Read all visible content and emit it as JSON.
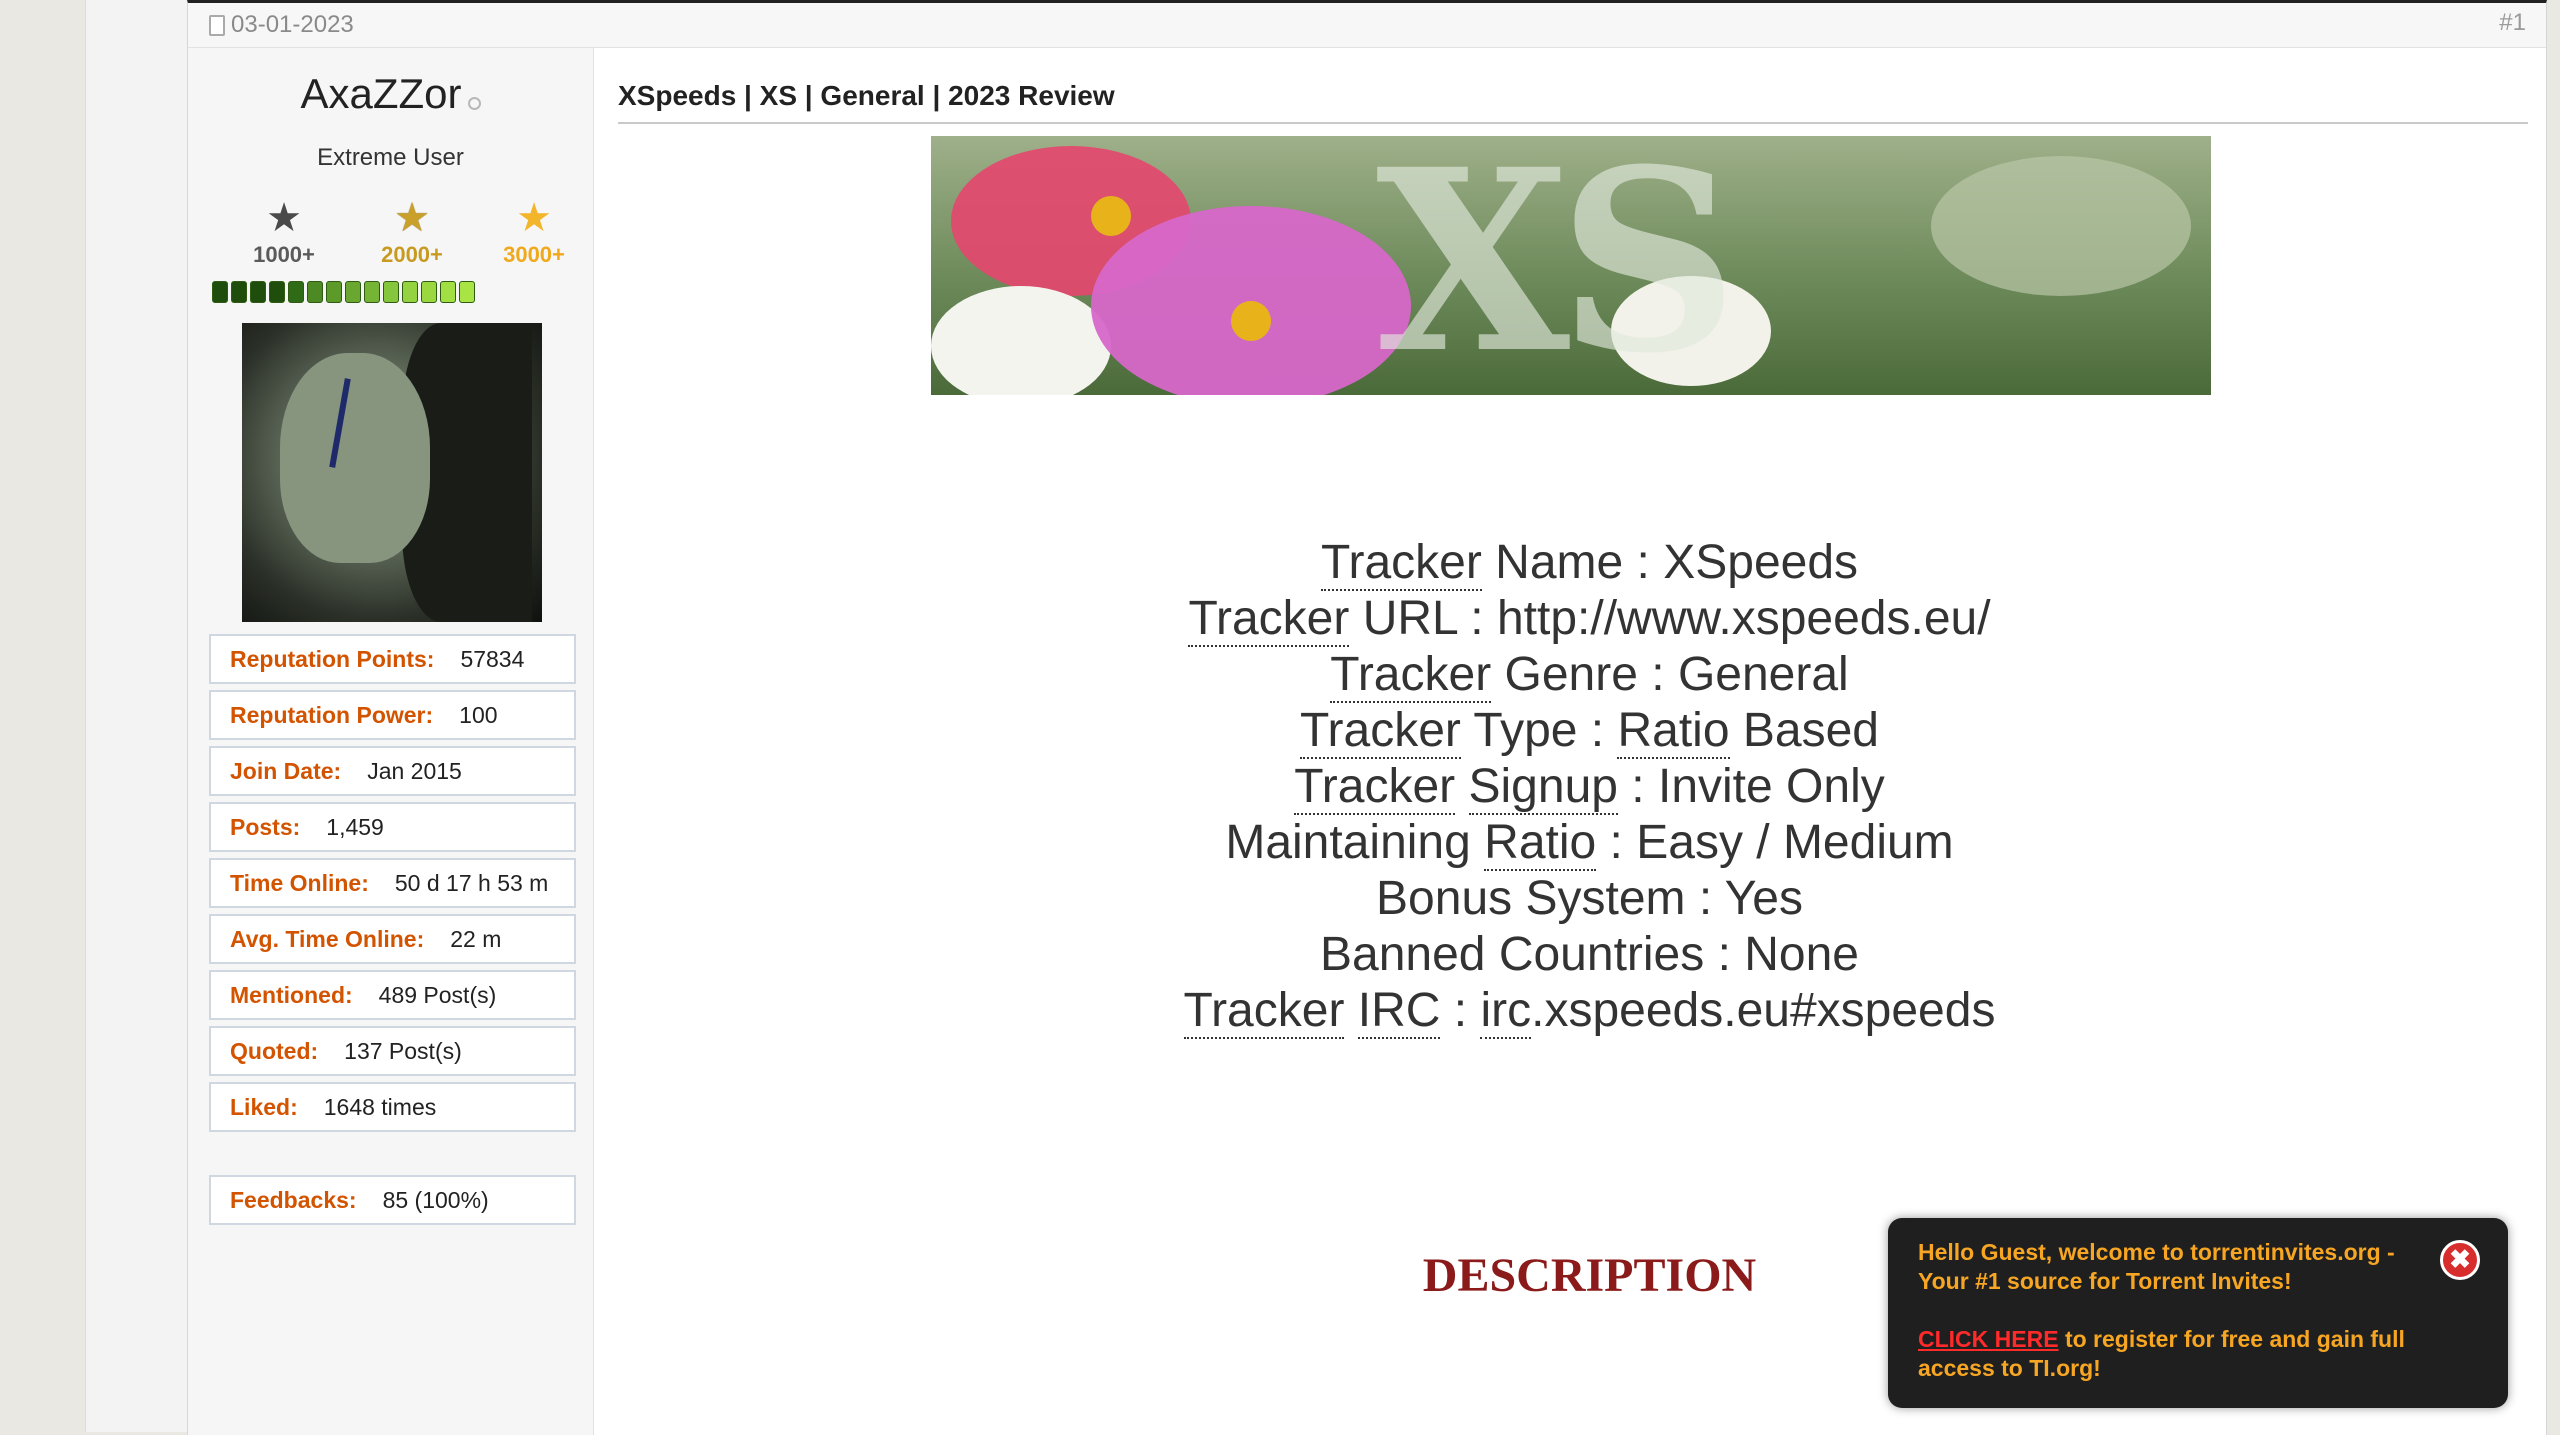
{
  "post": {
    "date": "03-01-2023",
    "number": "#1",
    "title": "XSpeeds | XS | General | 2023 Review"
  },
  "user": {
    "name": "AxaZZor",
    "title": "Extreme User",
    "ranks": [
      {
        "label": "1000+"
      },
      {
        "label": "2000+"
      },
      {
        "label": "3000+"
      }
    ],
    "reputation_pips": 14,
    "stats": [
      {
        "label": "Reputation Points:",
        "value": "57834"
      },
      {
        "label": "Reputation Power:",
        "value": "100"
      },
      {
        "label": "Join Date:",
        "value": "Jan 2015"
      },
      {
        "label": "Posts:",
        "value": "1,459"
      },
      {
        "label": "Time Online:",
        "value": "50 d 17 h 53 m"
      },
      {
        "label": "Avg. Time Online:",
        "value": "22 m"
      },
      {
        "label": "Mentioned:",
        "value": "489 Post(s)"
      },
      {
        "label": "Quoted:",
        "value": "137 Post(s)"
      },
      {
        "label": "Liked:",
        "value": "1648 times"
      }
    ],
    "feedbacks": {
      "label": "Feedbacks:",
      "value": "85 (100%)"
    }
  },
  "banner": {
    "logo_text": "XS"
  },
  "tracker": {
    "line1": {
      "a": "Tracker",
      "b": " Name : XSpeeds"
    },
    "line2": {
      "a": "Tracker",
      "b": " URL : ",
      "c": "http://www.xspeeds.eu/"
    },
    "line3": {
      "a": "Tracker",
      "b": " Genre : General"
    },
    "line4": {
      "a": "Tracker",
      "b": " Type : ",
      "c": "Ratio",
      "d": " Based"
    },
    "line5": {
      "a": "Tracker",
      "b": " ",
      "c": "Signup",
      "d": " : Invite Only"
    },
    "line6": {
      "a": "Maintaining ",
      "b": "Ratio",
      "c": " : Easy / Medium"
    },
    "line7": "Bonus System : Yes",
    "line8": "Banned Countries : None",
    "line9": {
      "a": "Tracker",
      "b": " ",
      "c": "IRC",
      "d": " : ",
      "e": "irc",
      "f": ".xspeeds.eu#xspeeds"
    }
  },
  "description_heading": "DESCRIPTION",
  "popup": {
    "welcome": "Hello Guest, welcome to torrentinvites.org - Your #1 source for Torrent Invites!",
    "link": "CLICK HERE",
    "rest": " to register for free and gain full access to TI.org!",
    "close": "✖"
  },
  "colors": {
    "label": "#d35400",
    "description": "#8b1a1a",
    "popup_text": "#f7a623"
  }
}
